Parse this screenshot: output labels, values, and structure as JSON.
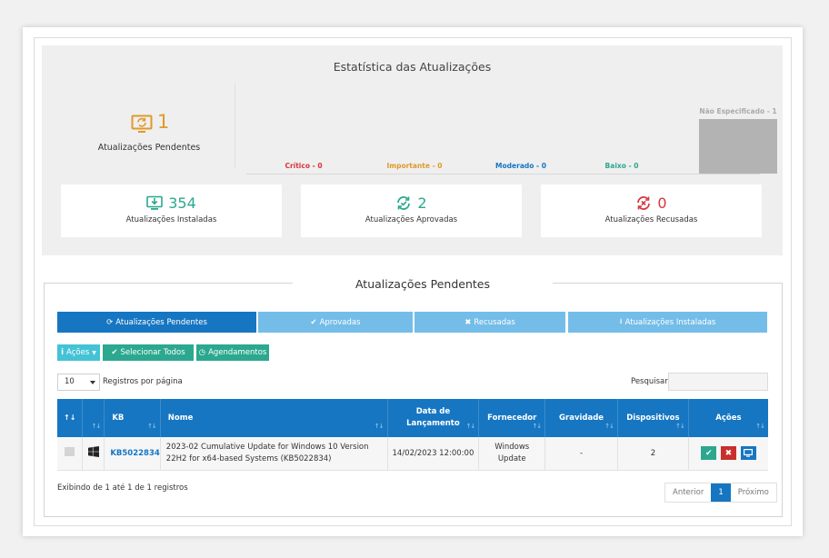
{
  "stats": {
    "title": "Estatística das Atualizações",
    "pending_count": "1",
    "pending_label": "Atualizações Pendentes",
    "pending_color": "#e09a2b"
  },
  "chart_data": {
    "type": "bar",
    "categories": [
      "Crítico",
      "Importante",
      "Moderado",
      "Baixo",
      "Não Especificado"
    ],
    "values": [
      0,
      0,
      0,
      0,
      1
    ],
    "labels": [
      "Crítico - 0",
      "Importante - 0",
      "Moderado - 0",
      "Baixo - 0",
      "Não Especificado - 1"
    ],
    "label_colors": [
      "#d9343b",
      "#e09a2b",
      "#1676c2",
      "#2ba88e",
      "#aaaaaa"
    ],
    "bar_color": "#b3b3b3",
    "ylim": [
      0,
      1
    ]
  },
  "cards": [
    {
      "count": "354",
      "label": "Atualizações Instaladas",
      "color": "#2ba88e",
      "icon": "download-monitor-icon"
    },
    {
      "count": "2",
      "label": "Atualizações Aprovadas",
      "color": "#2ba88e",
      "icon": "sync-check-icon"
    },
    {
      "count": "0",
      "label": "Atualizações Recusadas",
      "color": "#d9343b",
      "icon": "sync-x-icon"
    }
  ],
  "section": {
    "title": "Atualizações Pendentes",
    "tabs": [
      {
        "label": "Atualizações Pendentes",
        "icon": "refresh-icon"
      },
      {
        "label": "Aprovadas",
        "icon": "check-icon"
      },
      {
        "label": "Recusadas",
        "icon": "close-icon"
      },
      {
        "label": "Atualizações Instaladas",
        "icon": "download-icon"
      }
    ],
    "actions": {
      "acoes": "Ações",
      "select_all": "Selecionar Todos",
      "schedules": "Agendamentos"
    },
    "page_size": "10",
    "page_size_label": "Registros por página",
    "search_label": "Pesquisar",
    "search_value": "",
    "columns": [
      "KB",
      "Nome",
      "Data de Lançamento",
      "Fornecedor",
      "Gravidade",
      "Dispositivos",
      "Ações"
    ],
    "rows": [
      {
        "kb": "KB5022834",
        "name": "2023-02 Cumulative Update for Windows 10 Version 22H2 for x64-based Systems (KB5022834)",
        "date": "14/02/2023 12:00:00",
        "vendor": "Windows Update",
        "severity": "-",
        "devices": "2"
      }
    ],
    "showing": "Exibindo de 1 até 1 de 1 registros",
    "pager": {
      "prev": "Anterior",
      "current": "1",
      "next": "Próximo"
    }
  }
}
